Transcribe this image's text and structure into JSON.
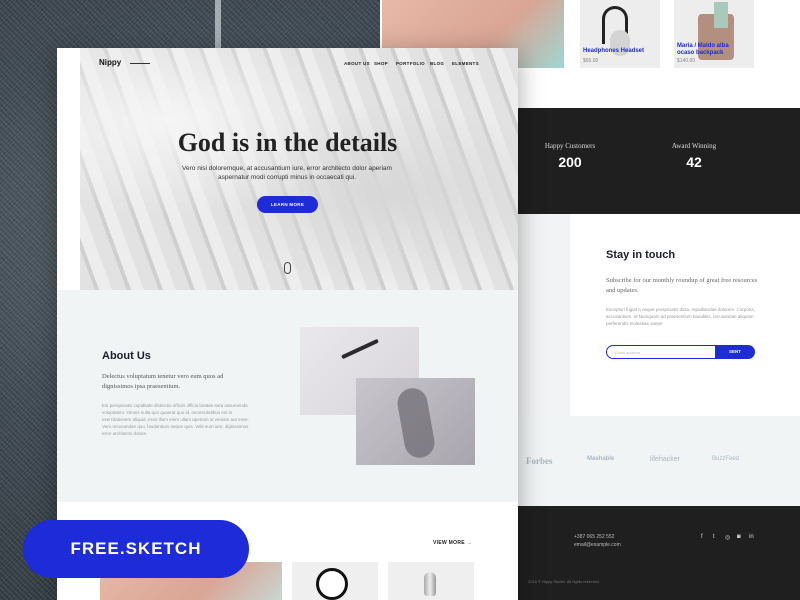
{
  "brand": {
    "name": "Nippy",
    "accent": "#1d2bd9",
    "dark": "#1f1f20"
  },
  "nav": [
    "ABOUT US",
    "SHOP",
    "PORTFOLIO",
    "BLOG",
    "ELEMENTS"
  ],
  "hero": {
    "title": "God is in the details",
    "subtitle": "Vero nisi doloremque, at accusantium iure, error architecto dolor aperiam aspernatur modi corrupti minus in occaecati qui.",
    "cta": "LEARN MORE"
  },
  "about": {
    "title": "About Us",
    "lead": "Delectus voluptatum tenetur vero eum quos ad dignissimos ipsa praesentium.",
    "body": "Est perspiciatis cupiditate distinctio officiis officia beatae sera assumenda voluptatem. Omnis nulla quo quaerat quo id, necessitatibus est in exercitationem aliquid, esse illum enim ullam aperiam ut veniam aut esse. Vero recusandae quo, laudantium neque quis. Velit eum iure, dignissimos error architecto dolore."
  },
  "shop_section": {
    "view_more": "VIEW MORE"
  },
  "back_products": [
    {
      "name": "Headphones Headset",
      "price": "$65.00"
    },
    {
      "name": "Maria / Maldo alba ocaso backpack",
      "price": "$140.00"
    }
  ],
  "stats": [
    {
      "label": "Happy Customers",
      "value": "200"
    },
    {
      "label": "Award Winning",
      "value": "42"
    }
  ],
  "newsletter": {
    "title": "Stay in touch",
    "lead": "Subscribe for our monthly roundup of great free resources and updates.",
    "body": "Excepturi fugiat a neque perspiciatis dicta, repudiandae dolorem. Corporis, accusantium, ut Numquam ad praesentium blanditiis, recusandae aliquam perferendis molestiae saepe",
    "placeholder": "Email address",
    "button": "SENT"
  },
  "press": [
    "Forbes",
    "Mashable",
    "lifehacker",
    "BuzzFeed"
  ],
  "footer": {
    "phone": "+387 065 252 552",
    "email": "email@example.com",
    "copyright": "2016 © Nippy Studio. All rights reserved",
    "social": [
      "f",
      "t",
      "◎",
      "◙",
      "in"
    ]
  },
  "badge": "FREE.SKETCH"
}
